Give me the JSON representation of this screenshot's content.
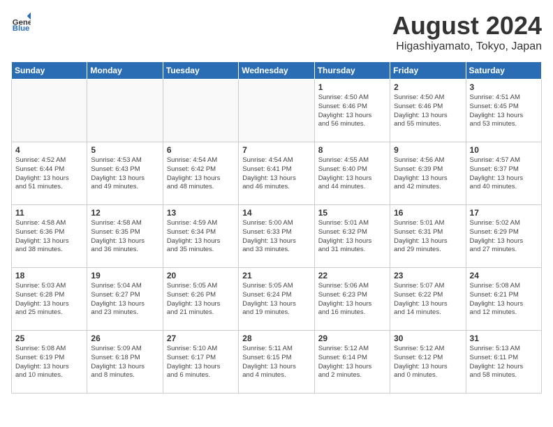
{
  "logo": {
    "text_general": "General",
    "text_blue": "Blue"
  },
  "title": "August 2024",
  "subtitle": "Higashiyamato, Tokyo, Japan",
  "headers": [
    "Sunday",
    "Monday",
    "Tuesday",
    "Wednesday",
    "Thursday",
    "Friday",
    "Saturday"
  ],
  "weeks": [
    [
      {
        "day": "",
        "info": ""
      },
      {
        "day": "",
        "info": ""
      },
      {
        "day": "",
        "info": ""
      },
      {
        "day": "",
        "info": ""
      },
      {
        "day": "1",
        "info": "Sunrise: 4:50 AM\nSunset: 6:46 PM\nDaylight: 13 hours\nand 56 minutes."
      },
      {
        "day": "2",
        "info": "Sunrise: 4:50 AM\nSunset: 6:46 PM\nDaylight: 13 hours\nand 55 minutes."
      },
      {
        "day": "3",
        "info": "Sunrise: 4:51 AM\nSunset: 6:45 PM\nDaylight: 13 hours\nand 53 minutes."
      }
    ],
    [
      {
        "day": "4",
        "info": "Sunrise: 4:52 AM\nSunset: 6:44 PM\nDaylight: 13 hours\nand 51 minutes."
      },
      {
        "day": "5",
        "info": "Sunrise: 4:53 AM\nSunset: 6:43 PM\nDaylight: 13 hours\nand 49 minutes."
      },
      {
        "day": "6",
        "info": "Sunrise: 4:54 AM\nSunset: 6:42 PM\nDaylight: 13 hours\nand 48 minutes."
      },
      {
        "day": "7",
        "info": "Sunrise: 4:54 AM\nSunset: 6:41 PM\nDaylight: 13 hours\nand 46 minutes."
      },
      {
        "day": "8",
        "info": "Sunrise: 4:55 AM\nSunset: 6:40 PM\nDaylight: 13 hours\nand 44 minutes."
      },
      {
        "day": "9",
        "info": "Sunrise: 4:56 AM\nSunset: 6:39 PM\nDaylight: 13 hours\nand 42 minutes."
      },
      {
        "day": "10",
        "info": "Sunrise: 4:57 AM\nSunset: 6:37 PM\nDaylight: 13 hours\nand 40 minutes."
      }
    ],
    [
      {
        "day": "11",
        "info": "Sunrise: 4:58 AM\nSunset: 6:36 PM\nDaylight: 13 hours\nand 38 minutes."
      },
      {
        "day": "12",
        "info": "Sunrise: 4:58 AM\nSunset: 6:35 PM\nDaylight: 13 hours\nand 36 minutes."
      },
      {
        "day": "13",
        "info": "Sunrise: 4:59 AM\nSunset: 6:34 PM\nDaylight: 13 hours\nand 35 minutes."
      },
      {
        "day": "14",
        "info": "Sunrise: 5:00 AM\nSunset: 6:33 PM\nDaylight: 13 hours\nand 33 minutes."
      },
      {
        "day": "15",
        "info": "Sunrise: 5:01 AM\nSunset: 6:32 PM\nDaylight: 13 hours\nand 31 minutes."
      },
      {
        "day": "16",
        "info": "Sunrise: 5:01 AM\nSunset: 6:31 PM\nDaylight: 13 hours\nand 29 minutes."
      },
      {
        "day": "17",
        "info": "Sunrise: 5:02 AM\nSunset: 6:29 PM\nDaylight: 13 hours\nand 27 minutes."
      }
    ],
    [
      {
        "day": "18",
        "info": "Sunrise: 5:03 AM\nSunset: 6:28 PM\nDaylight: 13 hours\nand 25 minutes."
      },
      {
        "day": "19",
        "info": "Sunrise: 5:04 AM\nSunset: 6:27 PM\nDaylight: 13 hours\nand 23 minutes."
      },
      {
        "day": "20",
        "info": "Sunrise: 5:05 AM\nSunset: 6:26 PM\nDaylight: 13 hours\nand 21 minutes."
      },
      {
        "day": "21",
        "info": "Sunrise: 5:05 AM\nSunset: 6:24 PM\nDaylight: 13 hours\nand 19 minutes."
      },
      {
        "day": "22",
        "info": "Sunrise: 5:06 AM\nSunset: 6:23 PM\nDaylight: 13 hours\nand 16 minutes."
      },
      {
        "day": "23",
        "info": "Sunrise: 5:07 AM\nSunset: 6:22 PM\nDaylight: 13 hours\nand 14 minutes."
      },
      {
        "day": "24",
        "info": "Sunrise: 5:08 AM\nSunset: 6:21 PM\nDaylight: 13 hours\nand 12 minutes."
      }
    ],
    [
      {
        "day": "25",
        "info": "Sunrise: 5:08 AM\nSunset: 6:19 PM\nDaylight: 13 hours\nand 10 minutes."
      },
      {
        "day": "26",
        "info": "Sunrise: 5:09 AM\nSunset: 6:18 PM\nDaylight: 13 hours\nand 8 minutes."
      },
      {
        "day": "27",
        "info": "Sunrise: 5:10 AM\nSunset: 6:17 PM\nDaylight: 13 hours\nand 6 minutes."
      },
      {
        "day": "28",
        "info": "Sunrise: 5:11 AM\nSunset: 6:15 PM\nDaylight: 13 hours\nand 4 minutes."
      },
      {
        "day": "29",
        "info": "Sunrise: 5:12 AM\nSunset: 6:14 PM\nDaylight: 13 hours\nand 2 minutes."
      },
      {
        "day": "30",
        "info": "Sunrise: 5:12 AM\nSunset: 6:12 PM\nDaylight: 13 hours\nand 0 minutes."
      },
      {
        "day": "31",
        "info": "Sunrise: 5:13 AM\nSunset: 6:11 PM\nDaylight: 12 hours\nand 58 minutes."
      }
    ]
  ]
}
